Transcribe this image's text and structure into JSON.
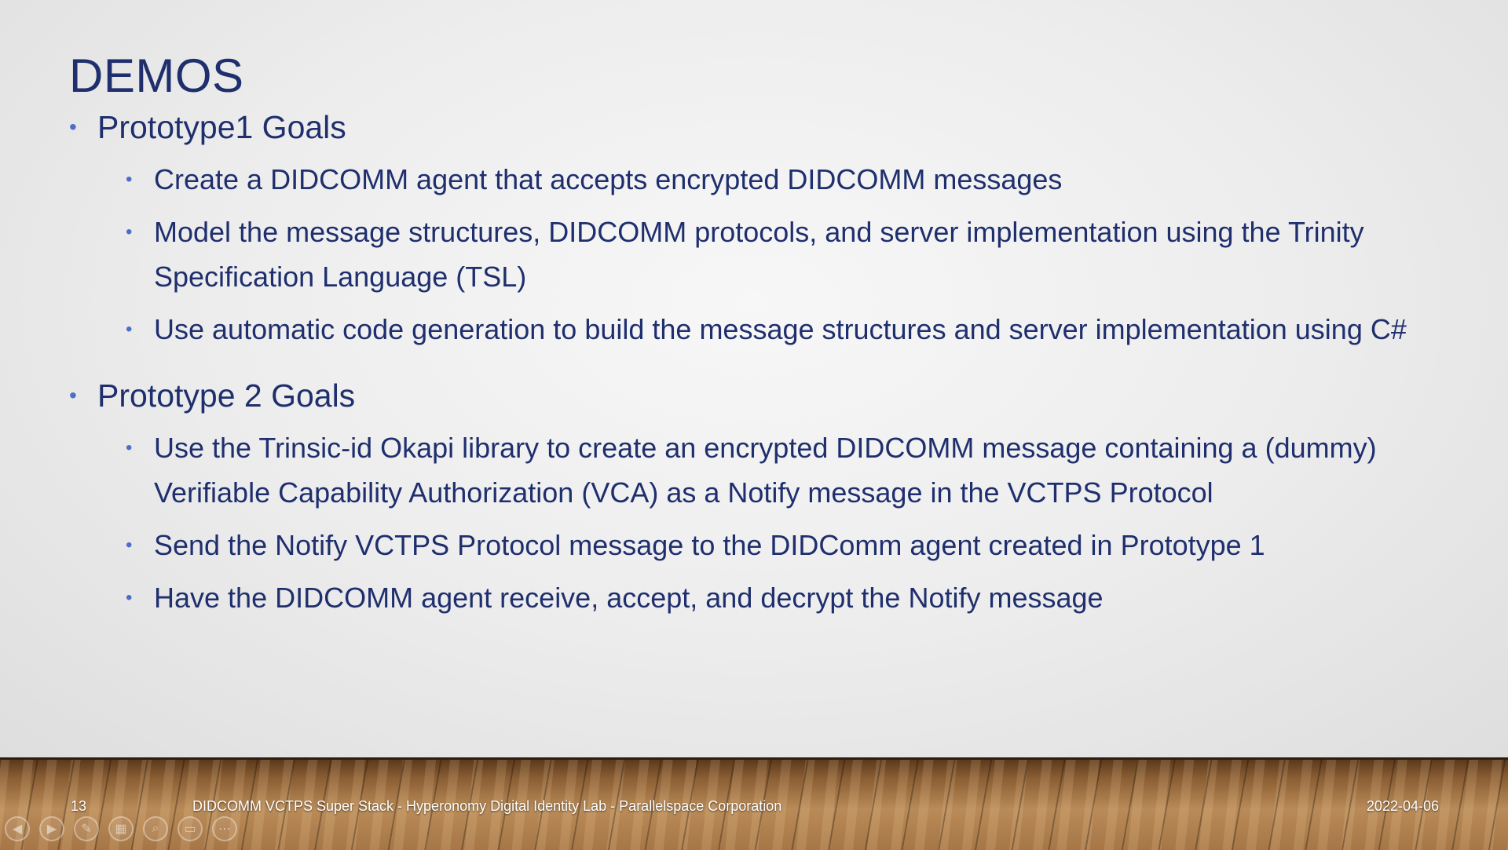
{
  "slide": {
    "title": "DEMOS",
    "sections": [
      {
        "heading": "Prototype1 Goals",
        "items": [
          "Create a DIDCOMM agent that accepts encrypted DIDCOMM messages",
          "Model the message structures, DIDCOMM protocols, and server implementation using the Trinity Specification Language (TSL)",
          "Use automatic code generation to build the message structures and server implementation using C#"
        ]
      },
      {
        "heading": "Prototype 2 Goals",
        "items": [
          "Use the Trinsic-id Okapi library to create an encrypted DIDCOMM message containing a (dummy) Verifiable Capability Authorization (VCA) as a Notify message in the VCTPS Protocol",
          "Send the Notify VCTPS Protocol message to the DIDComm agent created in Prototype 1",
          "Have the DIDCOMM agent receive, accept, and decrypt the Notify message"
        ]
      }
    ]
  },
  "footer": {
    "slide_number": "13",
    "title": "DIDCOMM VCTPS Super Stack - Hyperonomy Digital Identity Lab - Parallelspace Corporation",
    "date": "2022-04-06"
  },
  "controls": {
    "icons": [
      "previous-icon",
      "next-icon",
      "pen-icon",
      "slides-icon",
      "zoom-icon",
      "subtitles-icon",
      "more-icon"
    ]
  },
  "colors": {
    "text": "#1f2f6e",
    "bullet": "#4a6fc7"
  }
}
